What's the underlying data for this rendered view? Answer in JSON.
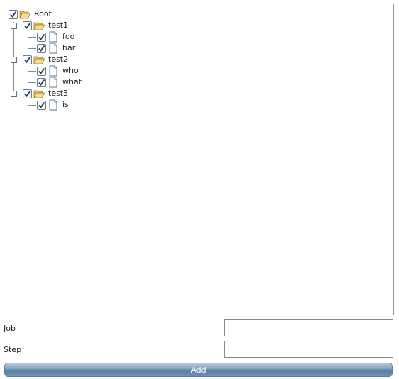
{
  "tree": {
    "root": {
      "label": "Root",
      "checked": true
    },
    "groups": [
      {
        "label": "test1",
        "checked": true,
        "expanded": true,
        "children": [
          {
            "label": "foo",
            "checked": true
          },
          {
            "label": "bar",
            "checked": true
          }
        ]
      },
      {
        "label": "test2",
        "checked": true,
        "expanded": true,
        "children": [
          {
            "label": "who",
            "checked": true
          },
          {
            "label": "what",
            "checked": true
          }
        ]
      },
      {
        "label": "test3",
        "checked": true,
        "expanded": true,
        "children": [
          {
            "label": "is",
            "checked": true
          }
        ]
      }
    ]
  },
  "form": {
    "job": {
      "label": "Job",
      "value": ""
    },
    "step": {
      "label": "Step",
      "value": ""
    }
  },
  "add_button": {
    "label": "Add"
  },
  "colors": {
    "checkmark": "#1f3a57",
    "folder_fill": "#f5d27a",
    "folder_stroke": "#9b7a2e",
    "button_text": "#ffffff",
    "panel_border": "#8a9aa9"
  }
}
